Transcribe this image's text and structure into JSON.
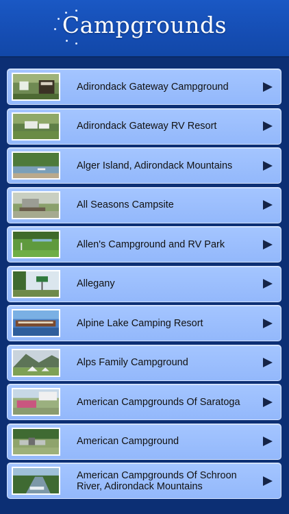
{
  "header": {
    "title": "Campgrounds"
  },
  "colors": {
    "header_blue": "#1a58c4",
    "background": "#0c2f74",
    "row_fill": "#a4c5ff",
    "arrow": "#152447"
  },
  "campgrounds": [
    {
      "name": "Adirondack Gateway Campground",
      "thumbnail": "campground-sign-photo"
    },
    {
      "name": "Adirondack Gateway RV Resort",
      "thumbnail": "rv-resort-sign-photo"
    },
    {
      "name": "Alger Island, Adirondack Mountains",
      "thumbnail": "lake-shore-photo"
    },
    {
      "name": "All Seasons Campsite",
      "thumbnail": "campsite-photo"
    },
    {
      "name": "Allen's Campground and RV Park",
      "thumbnail": "golf-field-photo"
    },
    {
      "name": "Allegany",
      "thumbnail": "road-sign-photo"
    },
    {
      "name": "Alpine Lake Camping Resort",
      "thumbnail": "lake-resort-photo"
    },
    {
      "name": "Alps Family Campground",
      "thumbnail": "mountain-tents-photo"
    },
    {
      "name": "American Campgrounds Of Saratoga",
      "thumbnail": "tent-event-photo"
    },
    {
      "name": "American Campground",
      "thumbnail": "park-grounds-photo"
    },
    {
      "name": "American Campgrounds Of Schroon River, Adirondack Mountains",
      "thumbnail": "river-photo"
    }
  ]
}
